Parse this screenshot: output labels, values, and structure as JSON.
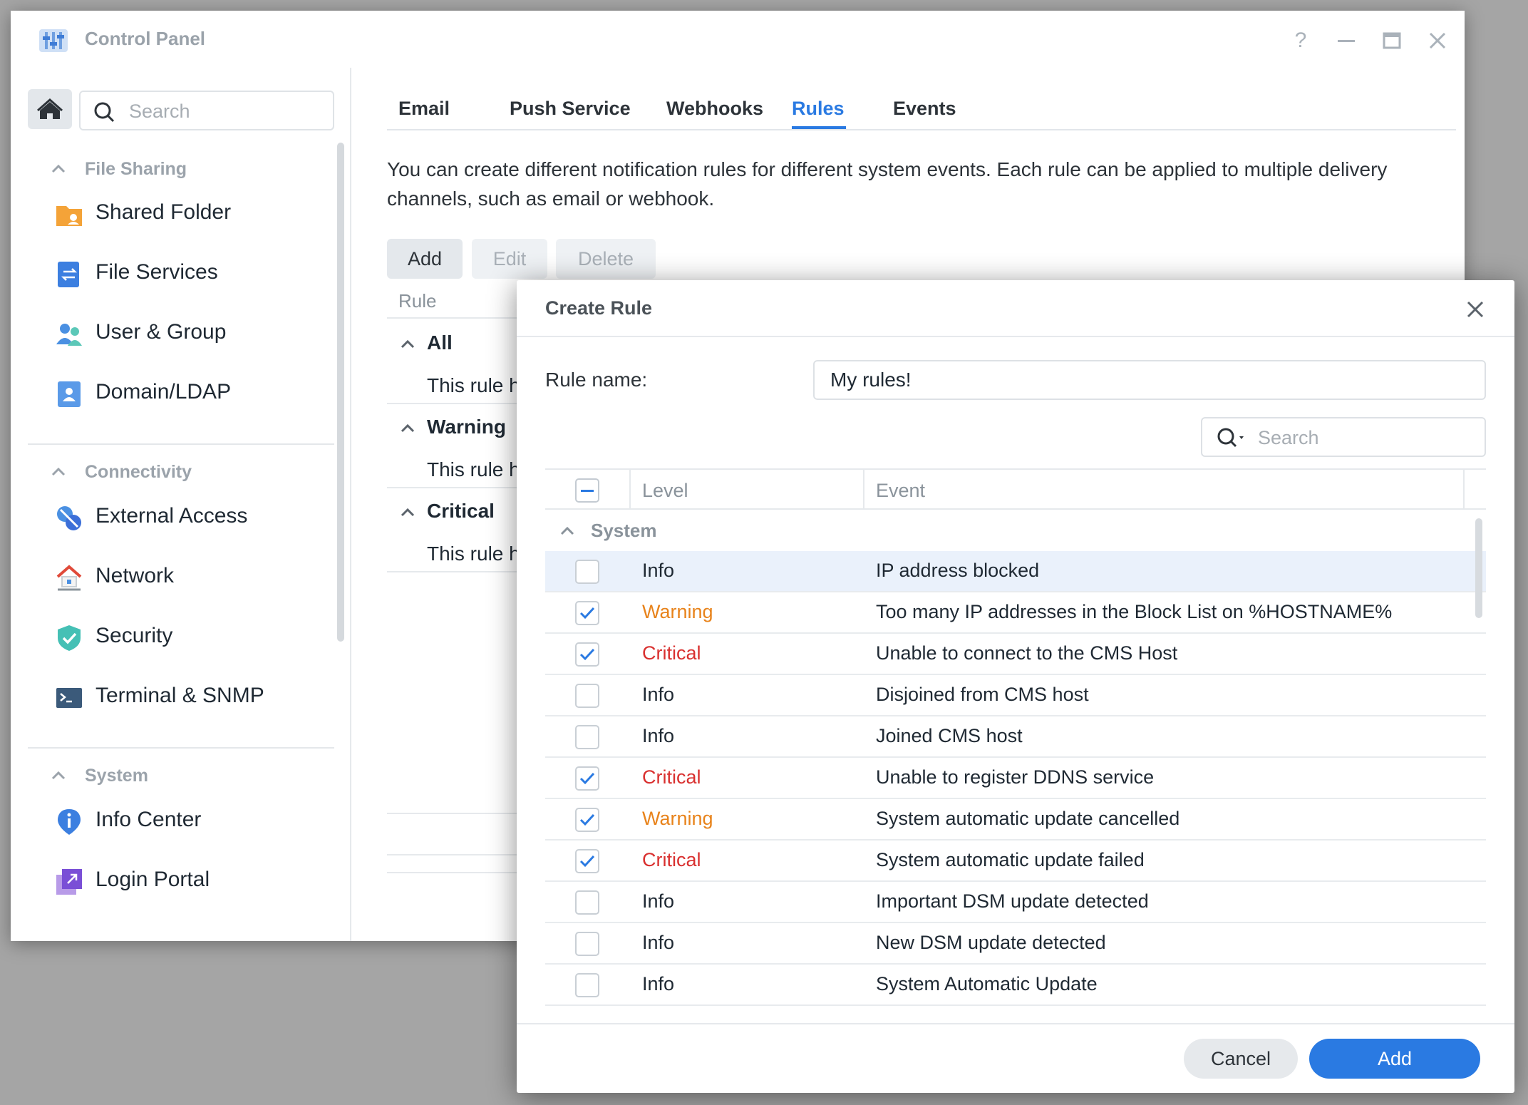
{
  "window": {
    "title": "Control Panel"
  },
  "sidebar": {
    "search_placeholder": "Search",
    "sections": [
      {
        "label": "File Sharing",
        "items": [
          {
            "label": "Shared Folder",
            "icon": "shared-folder-icon"
          },
          {
            "label": "File Services",
            "icon": "file-services-icon"
          },
          {
            "label": "User & Group",
            "icon": "user-group-icon"
          },
          {
            "label": "Domain/LDAP",
            "icon": "domain-ldap-icon"
          }
        ]
      },
      {
        "label": "Connectivity",
        "items": [
          {
            "label": "External Access",
            "icon": "external-access-icon"
          },
          {
            "label": "Network",
            "icon": "network-icon"
          },
          {
            "label": "Security",
            "icon": "security-shield-icon"
          },
          {
            "label": "Terminal & SNMP",
            "icon": "terminal-icon"
          }
        ]
      },
      {
        "label": "System",
        "items": [
          {
            "label": "Info Center",
            "icon": "info-center-icon"
          },
          {
            "label": "Login Portal",
            "icon": "login-portal-icon"
          }
        ]
      }
    ]
  },
  "tabs": [
    "Email",
    "Push Service",
    "Webhooks",
    "Rules",
    "Events"
  ],
  "active_tab": "Rules",
  "description": "You can create different notification rules for different system events. Each rule can be applied to multiple delivery channels, such as email or webhook.",
  "toolbar": {
    "add": "Add",
    "edit": "Edit",
    "delete": "Delete"
  },
  "rules_table": {
    "header": "Rule",
    "groups": [
      {
        "name": "All",
        "desc": "This rule ha"
      },
      {
        "name": "Warning",
        "desc": "This rule ha"
      },
      {
        "name": "Critical",
        "desc": "This rule ha"
      }
    ]
  },
  "dialog": {
    "title": "Create Rule",
    "rule_name_label": "Rule name:",
    "rule_name_value": "My rules!",
    "search_placeholder": "Search",
    "columns": {
      "level": "Level",
      "event": "Event"
    },
    "group": "System",
    "rows": [
      {
        "checked": false,
        "level": "Info",
        "event": "IP address blocked",
        "selected": true
      },
      {
        "checked": true,
        "level": "Warning",
        "event": "Too many IP addresses in the Block List on %HOSTNAME%"
      },
      {
        "checked": true,
        "level": "Critical",
        "event": "Unable to connect to the CMS Host"
      },
      {
        "checked": false,
        "level": "Info",
        "event": "Disjoined from CMS host"
      },
      {
        "checked": false,
        "level": "Info",
        "event": "Joined CMS host"
      },
      {
        "checked": true,
        "level": "Critical",
        "event": "Unable to register DDNS service"
      },
      {
        "checked": true,
        "level": "Warning",
        "event": "System automatic update cancelled"
      },
      {
        "checked": true,
        "level": "Critical",
        "event": "System automatic update failed"
      },
      {
        "checked": false,
        "level": "Info",
        "event": "Important DSM update detected"
      },
      {
        "checked": false,
        "level": "Info",
        "event": "New DSM update detected"
      },
      {
        "checked": false,
        "level": "Info",
        "event": "System Automatic Update"
      }
    ],
    "cancel": "Cancel",
    "add": "Add"
  },
  "colors": {
    "accent": "#2a7ae2",
    "info": "#1f2933",
    "warning": "#e8831b",
    "critical": "#d9302f"
  }
}
